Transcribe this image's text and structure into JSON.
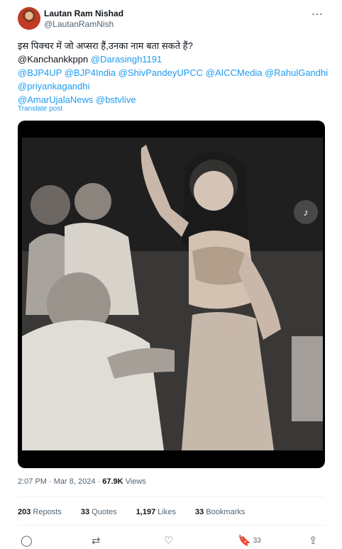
{
  "author": {
    "name": "Lautan Ram Nishad",
    "handle": "@LautanRamNish"
  },
  "tweet": {
    "line1": "इस  पिक्चर में जो अप्सरा हैं,उनका नाम बता सकते हैं?",
    "line2_plain": "@Kanchankkppn",
    "line2_mention": "@Darasingh1191",
    "line3": "@BJP4UP @BJP4India @ShivPandeyUPCC @AICCMedia @RahulGandhi",
    "line4": "@priyankagandhi",
    "line5": "@AmarUjalaNews @bstvlive"
  },
  "translate_label": "Translate post",
  "meta": {
    "time": "2:07 PM · Mar 8, 2024",
    "views_count": "67.9K",
    "views_label": "Views"
  },
  "stats": {
    "reposts_count": "203",
    "reposts_label": "Reposts",
    "quotes_count": "33",
    "quotes_label": "Quotes",
    "likes_count": "1,197",
    "likes_label": "Likes",
    "bookmarks_count": "33",
    "bookmarks_label": "Bookmarks"
  },
  "actions": {
    "bookmark_count": "33"
  },
  "icons": {
    "more": "more-icon",
    "sound": "sound-icon",
    "reply": "reply-icon",
    "retweet": "retweet-icon",
    "like": "heart-icon",
    "bookmark": "bookmark-icon",
    "share": "share-icon"
  },
  "colors": {
    "link": "#1d9bf0",
    "secondary_text": "#536471"
  }
}
